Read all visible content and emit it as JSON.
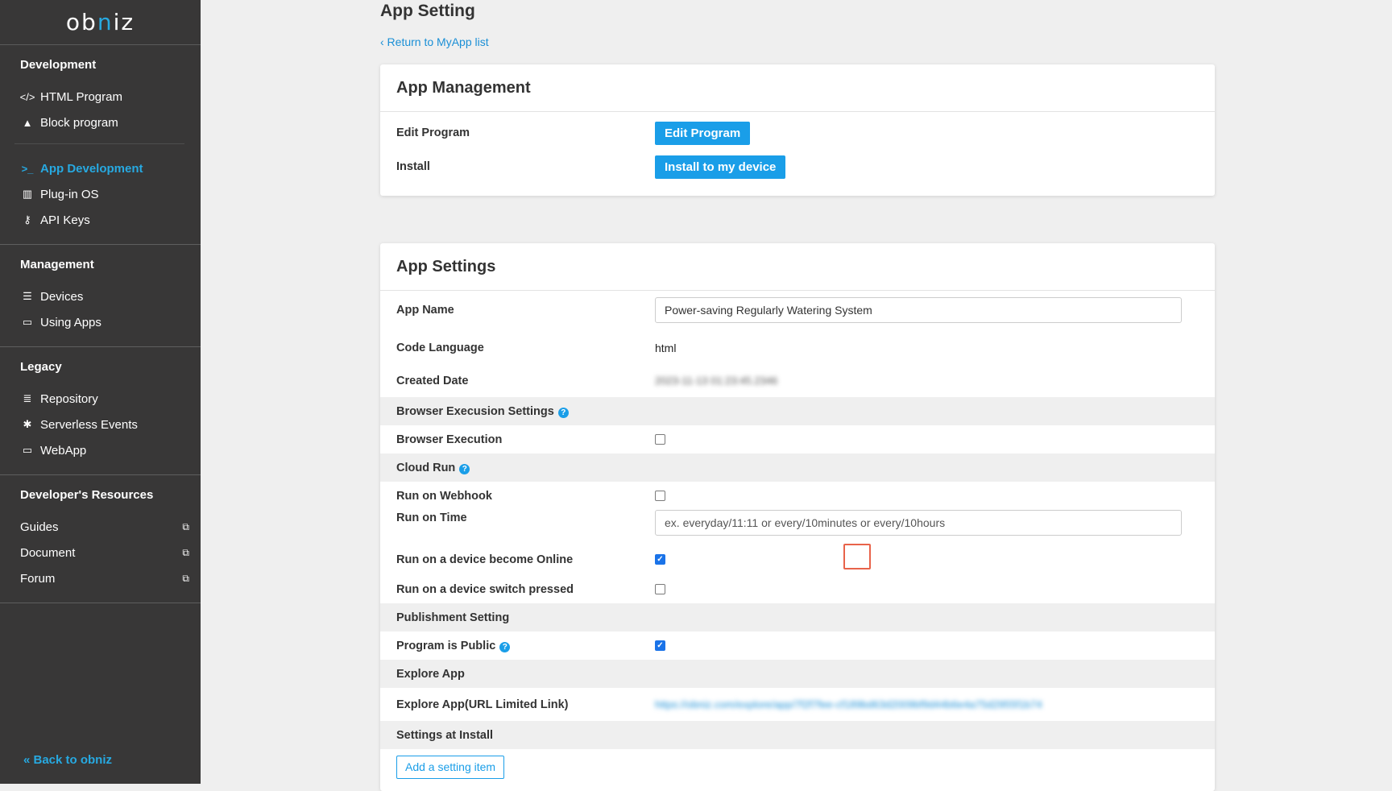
{
  "logo": {
    "left": "ob",
    "i": "n",
    "right": "iz"
  },
  "sidebar": {
    "development": {
      "title": "Development",
      "items": [
        {
          "label": "HTML Program",
          "icon": "code-icon"
        },
        {
          "label": "Block program",
          "icon": "shapes-icon"
        }
      ],
      "items2": [
        {
          "label": "App Development",
          "icon": "terminal-icon",
          "active": true
        },
        {
          "label": "Plug-in OS",
          "icon": "chip-icon"
        },
        {
          "label": "API Keys",
          "icon": "key-icon"
        }
      ]
    },
    "management": {
      "title": "Management",
      "items": [
        {
          "label": "Devices",
          "icon": "list-icon"
        },
        {
          "label": "Using Apps",
          "icon": "laptop-icon"
        }
      ]
    },
    "legacy": {
      "title": "Legacy",
      "items": [
        {
          "label": "Repository",
          "icon": "server-icon"
        },
        {
          "label": "Serverless Events",
          "icon": "network-icon"
        },
        {
          "label": "WebApp",
          "icon": "laptop-icon"
        }
      ]
    },
    "resources": {
      "title": "Developer's Resources",
      "items": [
        {
          "label": "Guides",
          "icon": "external-link-icon"
        },
        {
          "label": "Document",
          "icon": "external-link-icon"
        },
        {
          "label": "Forum",
          "icon": "external-link-icon"
        }
      ]
    },
    "back_label": "« Back to obniz"
  },
  "main": {
    "title": "App Setting",
    "return_label": "‹  Return to MyApp list",
    "management_card": {
      "title": "App Management",
      "edit_program_label": "Edit Program",
      "edit_program_button": "Edit Program",
      "install_label": "Install",
      "install_button": "Install to my device"
    },
    "settings_card": {
      "title": "App Settings",
      "app_name_label": "App Name",
      "app_name_value": "Power-saving Regularly Watering System",
      "code_language_label": "Code Language",
      "code_language_value": "html",
      "created_date_label": "Created Date",
      "created_date_value": "2023-11-13 01:23:45.2346",
      "browser_exec_settings_label": "Browser Execusion Settings",
      "browser_execution_label": "Browser Execution",
      "browser_execution_checked": false,
      "cloud_run_label": "Cloud Run",
      "run_on_webhook_label": "Run on Webhook",
      "run_on_webhook_checked": false,
      "run_on_time_label": "Run on Time",
      "run_on_time_placeholder": "ex. everyday/11:11 or every/10minutes or every/10hours",
      "run_online_label": "Run on a device become Online",
      "run_online_checked": true,
      "run_switch_label": "Run on a device switch pressed",
      "run_switch_checked": false,
      "publishment_label": "Publishment Setting",
      "program_public_label": "Program is Public",
      "program_public_checked": true,
      "explore_app_label": "Explore App",
      "explore_app_link_label": "Explore App(URL Limited Link)",
      "explore_app_link_value": "https://obniz.com/explore/app/7f2f7fee-cf189bd63d2009bf9d44b6e4a75d2955f1b74",
      "settings_at_install_label": "Settings at Install",
      "add_setting_button": "Add a setting item"
    }
  },
  "colors": {
    "accent": "#27a9e1",
    "primary_button": "#1a9ee8",
    "sidebar_bg": "#383737",
    "highlight": "#e8634a"
  }
}
